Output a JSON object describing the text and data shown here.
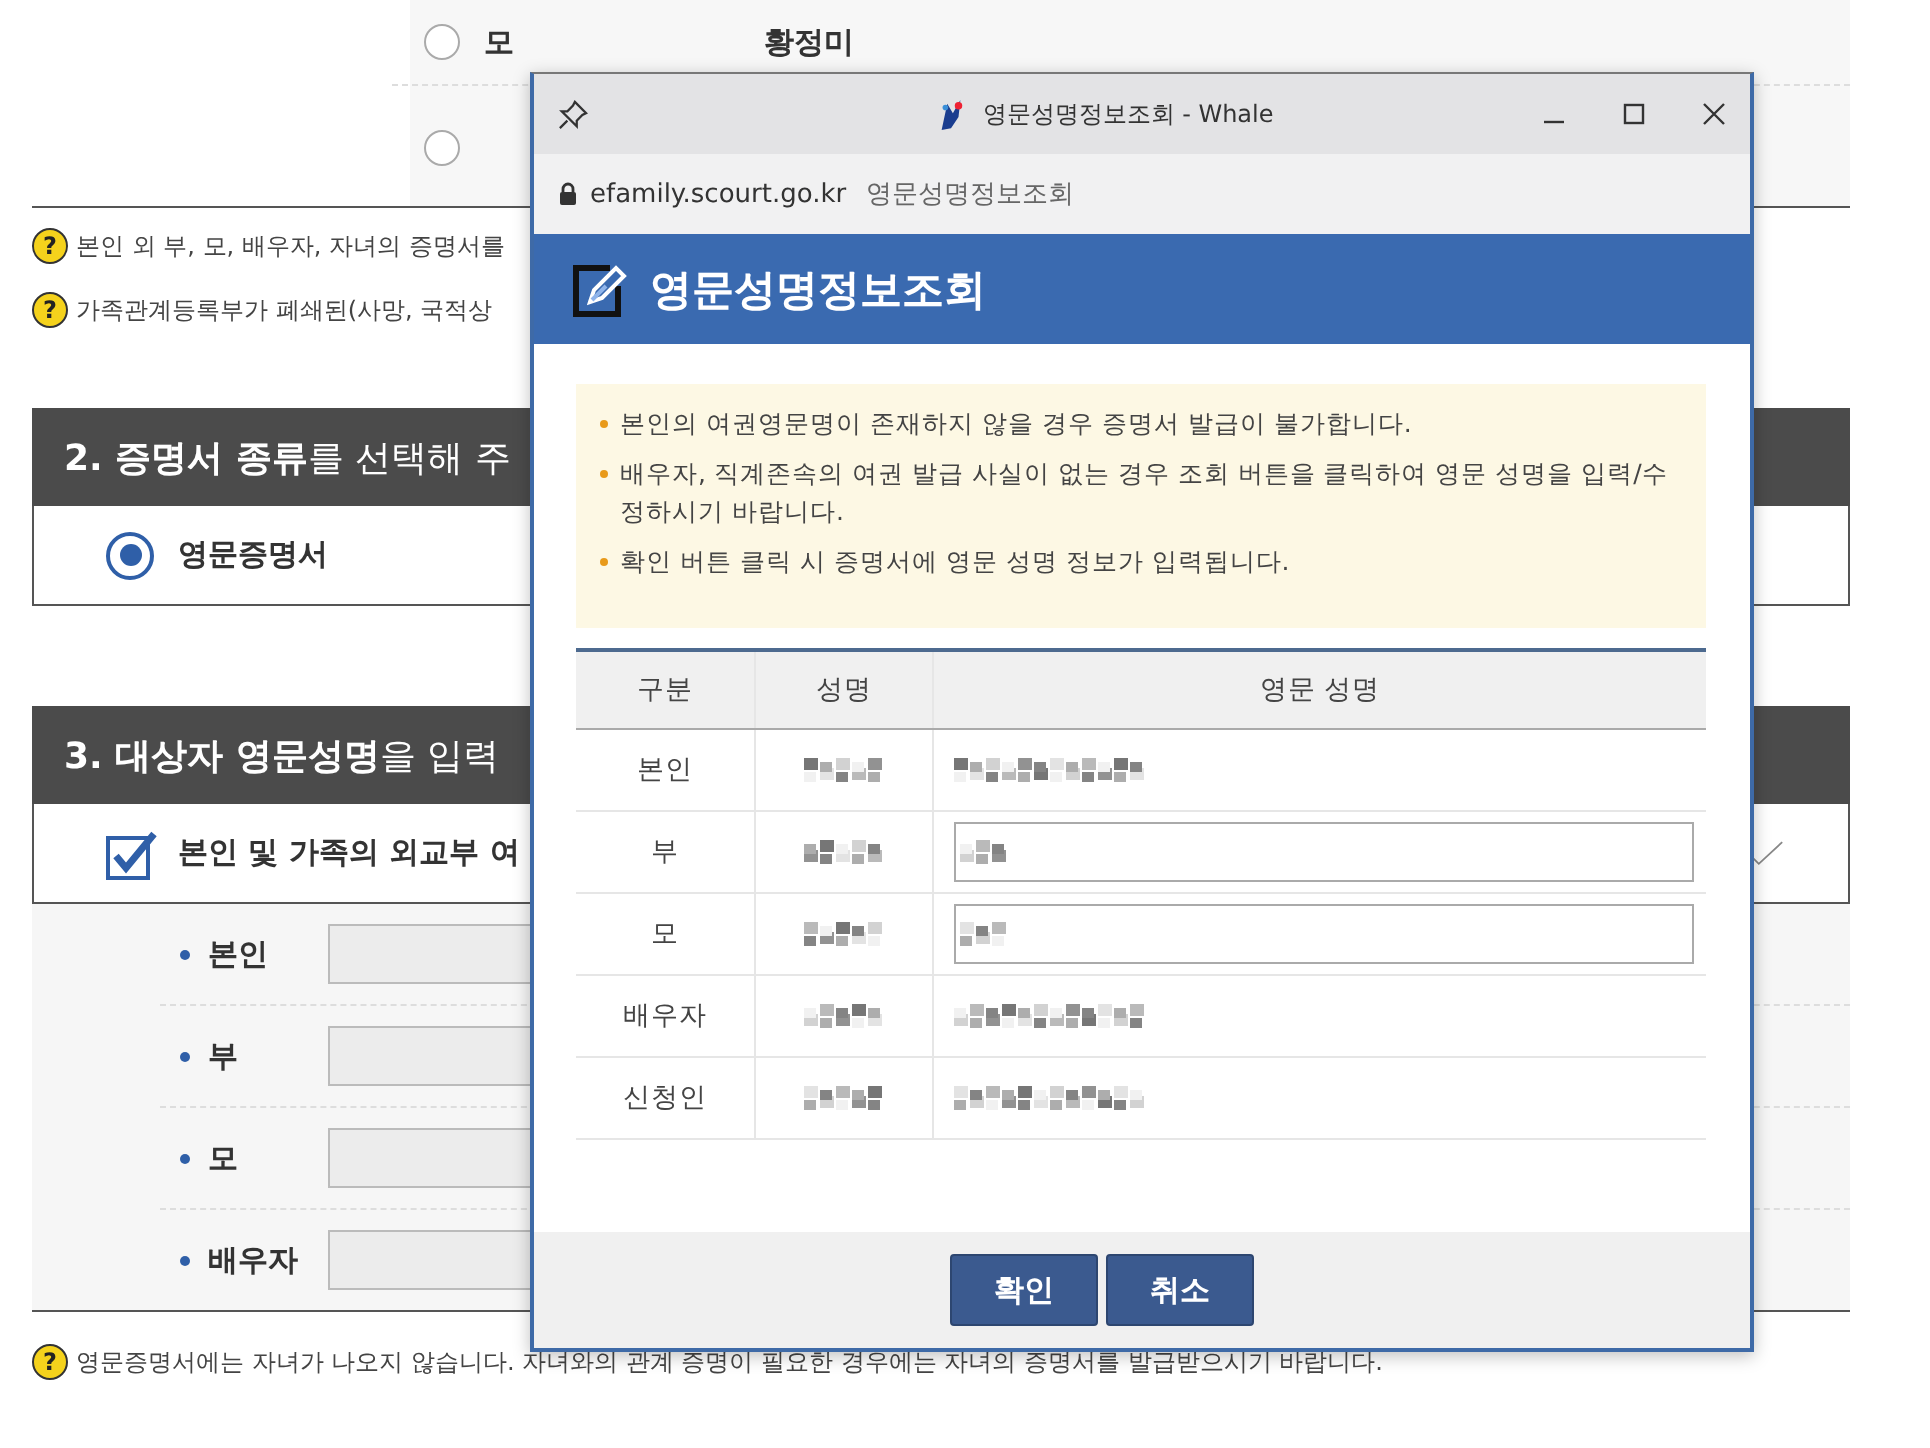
{
  "background_page": {
    "top_rows": [
      {
        "relation": "모",
        "name": "황정미",
        "selected": false
      },
      {
        "selected": false
      }
    ],
    "help_notes": [
      {
        "icon": "?",
        "text": "본인 외 부, 모, 배우자, 자녀의 증명서를"
      },
      {
        "icon": "?",
        "text": "가족관계등록부가 폐쇄된(사망, 국적상"
      }
    ],
    "section_2": {
      "title": "**2. 증명서 종류**를 선택해 주",
      "options": [
        {
          "label": "영문증명서",
          "selected": true
        }
      ]
    },
    "section_3": {
      "title": "**3. 대상자 영문성명**을 입력",
      "checkbox": {
        "label": "본인 및 가족의 외교부 여",
        "checked": true
      },
      "fields": [
        {
          "label": "본인",
          "disabled": true
        },
        {
          "label": "부",
          "disabled": true
        },
        {
          "label": "모",
          "disabled": true
        },
        {
          "label": "배우자",
          "disabled": true
        }
      ]
    },
    "footer_note": {
      "icon": "?",
      "text": "영문증명서에는 자녀가 나오지 않습니다. 자녀와의 관계 증명이 필요한 경우에는 자녀의 증명서를 발급받으시기 바랍니다."
    }
  },
  "popup": {
    "window_title": "영문성명정보조회 - Whale",
    "address": {
      "domain": "efamily.scourt.go.kr",
      "page_title": "영문성명정보조회"
    },
    "heading": "영문성명정보조회",
    "notices": [
      "본인의 여권영문명이 존재하지 않을 경우 증명서 발급이 불가합니다.",
      "배우자, 직계존속의 여권 발급 사실이 없는 경우 조회 버튼을 클릭하여 영문 성명을 입력/수정하시기 바랍니다.",
      "확인 버튼 클릭 시 증명서에 영문 성명 정보가 입력됩니다."
    ],
    "table": {
      "columns": [
        "구분",
        "성명",
        "영문 성명"
      ],
      "rows": [
        {
          "relation": "본인",
          "kind": "text"
        },
        {
          "relation": "부",
          "kind": "input"
        },
        {
          "relation": "모",
          "kind": "input"
        },
        {
          "relation": "배우자",
          "kind": "text"
        },
        {
          "relation": "신청인",
          "kind": "text"
        }
      ]
    },
    "buttons": [
      "확인",
      "취소"
    ]
  }
}
